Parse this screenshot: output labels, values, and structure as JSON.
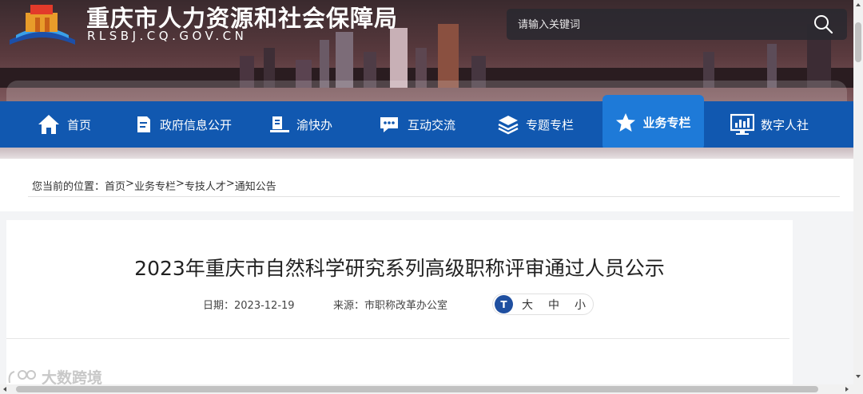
{
  "header": {
    "site_title": "重庆市人力资源和社会保障局",
    "site_domain": "RLSBJ.CQ.GOV.CN",
    "search_placeholder": "请输入关键词"
  },
  "nav": {
    "items": [
      {
        "label": "首页",
        "icon": "home-icon"
      },
      {
        "label": "政府信息公开",
        "icon": "document-icon"
      },
      {
        "label": "渝快办",
        "icon": "desk-icon"
      },
      {
        "label": "互动交流",
        "icon": "chat-icon"
      },
      {
        "label": "专题专栏",
        "icon": "layers-icon"
      },
      {
        "label": "业务专栏",
        "icon": "star-icon",
        "active": true
      },
      {
        "label": "数字人社",
        "icon": "monitor-chart-icon"
      }
    ],
    "active_color": "#1e7ad8",
    "bar_color": "#1158b0"
  },
  "breadcrumb": {
    "prefix": "您当前的位置：",
    "items": [
      "首页",
      "业务专栏",
      "专技人才",
      "通知公告"
    ],
    "separator": ">"
  },
  "article": {
    "title": "2023年重庆市自然科学研究系列高级职称评审通过人员公示",
    "date_label": "日期：",
    "date": "2023-12-19",
    "source_label": "来源：",
    "source": "市职称改革办公室",
    "font_sizes": [
      "大",
      "中",
      "小"
    ],
    "font_icon_text": "T"
  },
  "watermark": "大数跨境"
}
